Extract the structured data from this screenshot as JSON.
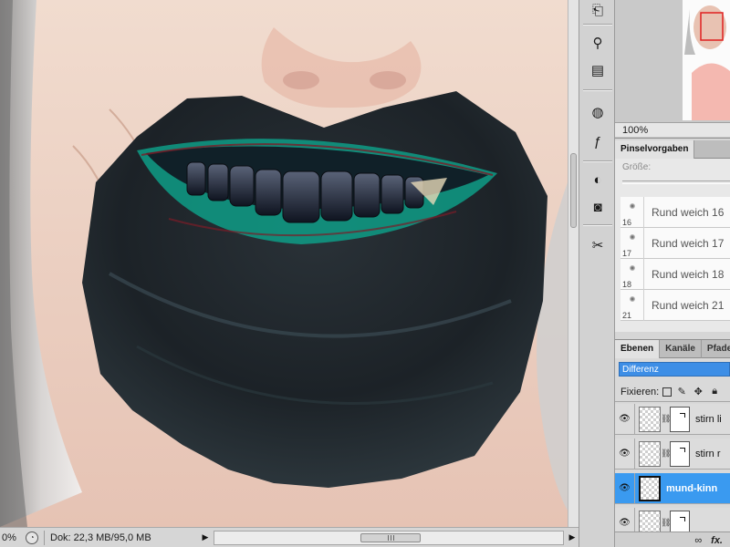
{
  "canvas": {
    "description_icon": "image-canvas"
  },
  "status_bar": {
    "zoom": "0%",
    "doc_info": "Dok: 22,3 MB/95,0 MB"
  },
  "tools": [
    {
      "name": "history-icon",
      "glyph": "⎗"
    },
    {
      "name": "clone-source-icon",
      "glyph": "⚲"
    },
    {
      "name": "actions-icon",
      "glyph": "▤"
    },
    {
      "name": "color-swatches-icon",
      "glyph": "◍"
    },
    {
      "name": "styles-icon",
      "glyph": "ƒ"
    },
    {
      "name": "adjustments-icon",
      "glyph": "◐"
    },
    {
      "name": "masks-icon",
      "glyph": "◙"
    },
    {
      "name": "tool-presets-icon",
      "glyph": "✂"
    }
  ],
  "navigator": {
    "zoom": "100%"
  },
  "brush_presets": {
    "tab_label": "Pinselvorgaben",
    "size_label": "Größe:",
    "items": [
      {
        "size": "16",
        "name": "Rund weich 16"
      },
      {
        "size": "17",
        "name": "Rund weich 17"
      },
      {
        "size": "18",
        "name": "Rund weich 18"
      },
      {
        "size": "21",
        "name": "Rund weich 21"
      }
    ]
  },
  "layers": {
    "tabs": [
      "Ebenen",
      "Kanäle",
      "Pfade"
    ],
    "blend_mode": "Differenz",
    "lock_label": "Fixieren:",
    "rows": [
      {
        "name": "stirn li",
        "has_mask": true,
        "selected": false
      },
      {
        "name": "stirn r",
        "has_mask": true,
        "selected": false
      },
      {
        "name": "mund-kinn",
        "has_mask": false,
        "selected": true
      },
      {
        "name": "",
        "has_mask": true,
        "selected": false
      }
    ],
    "footer_link": "∞",
    "footer_fx": "fx."
  }
}
